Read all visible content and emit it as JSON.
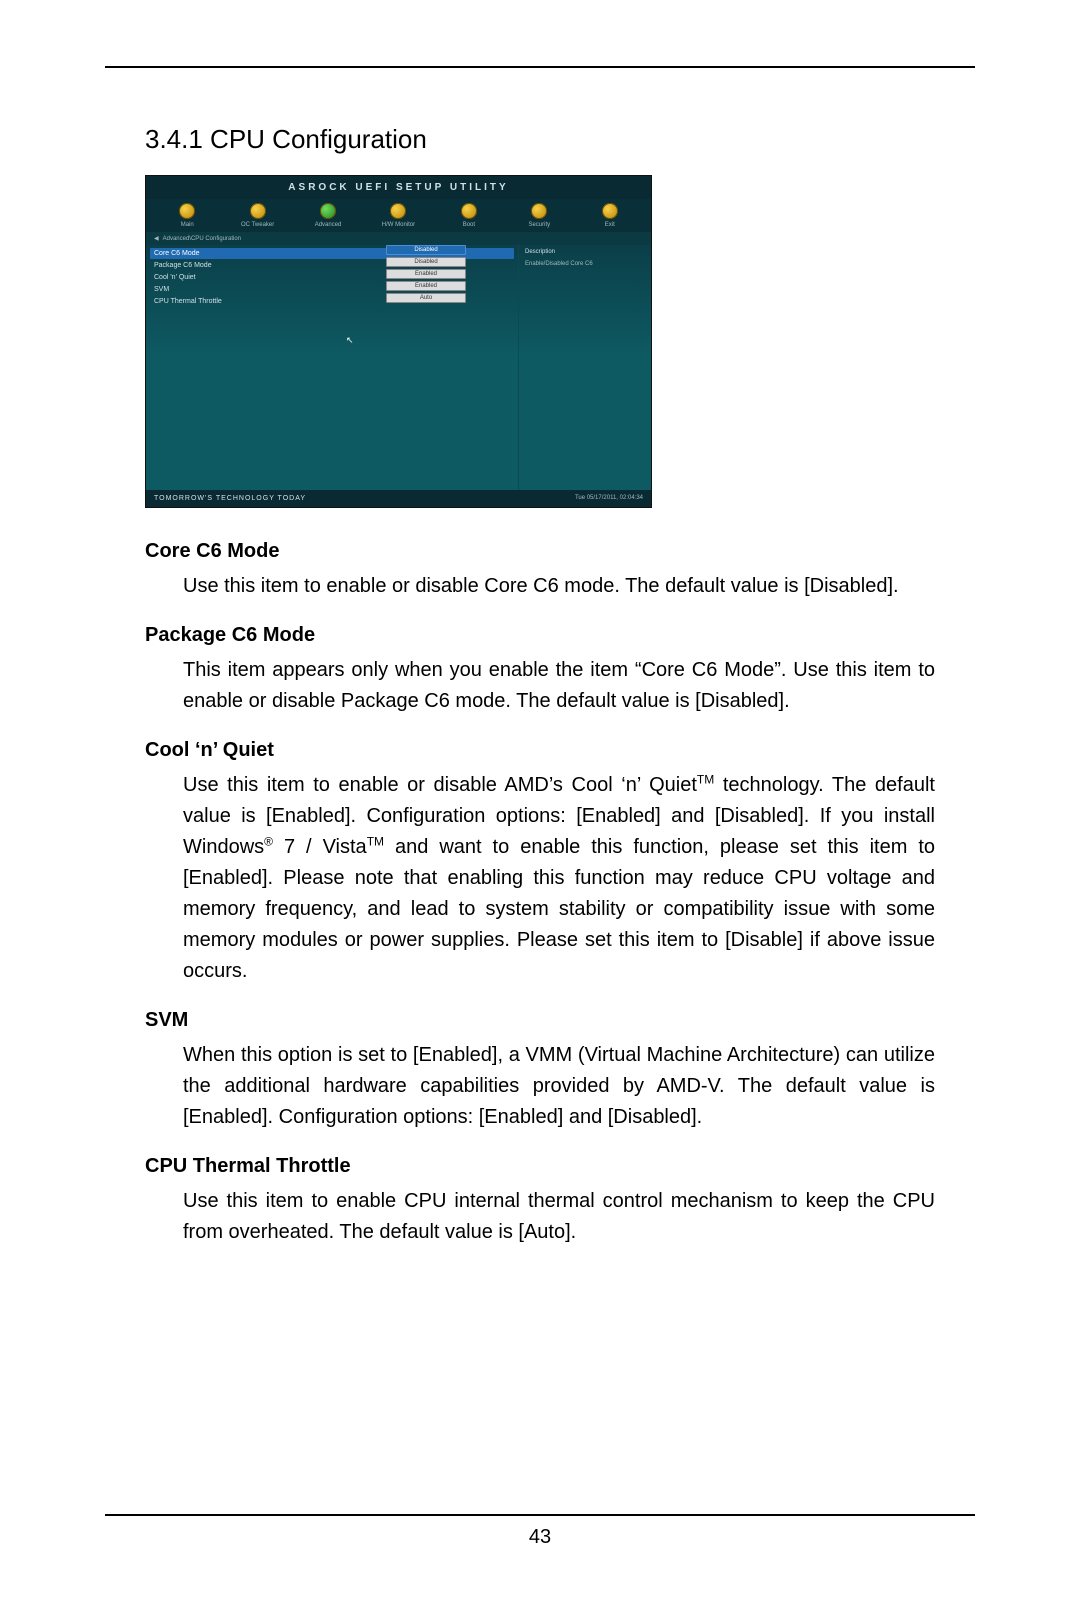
{
  "section_title": "3.4.1  CPU Configuration",
  "page_number": "43",
  "bios": {
    "header": "ASROCK UEFI SETUP UTILITY",
    "menu": [
      {
        "label": "Main"
      },
      {
        "label": "OC Tweaker"
      },
      {
        "label": "Advanced"
      },
      {
        "label": "H/W Monitor"
      },
      {
        "label": "Boot"
      },
      {
        "label": "Security"
      },
      {
        "label": "Exit"
      }
    ],
    "breadcrumb": "Advanced\\CPU Configuration",
    "rows": [
      {
        "label": "Core C6 Mode",
        "value": "Disabled",
        "selected": true
      },
      {
        "label": "Package C6 Mode",
        "value": "Disabled"
      },
      {
        "label": "Cool 'n' Quiet",
        "value": "Enabled"
      },
      {
        "label": "SVM",
        "value": "Enabled"
      },
      {
        "label": "CPU Thermal Throttle",
        "value": "Auto"
      }
    ],
    "options": [
      {
        "label": "Disabled",
        "selected": true
      },
      {
        "label": "Disabled"
      },
      {
        "label": "Enabled"
      },
      {
        "label": "Enabled"
      },
      {
        "label": "Auto"
      }
    ],
    "side_header": "Description",
    "side_text": "Enable/Disabled Core C6",
    "footer_left": "TOMORROW'S TECHNOLOGY TODAY",
    "footer_right": "Tue 05/17/2011, 02:04:34"
  },
  "items": [
    {
      "title": "Core C6 Mode",
      "desc": "Use this item to enable or disable Core C6 mode. The default value is [Disabled]."
    },
    {
      "title": "Package C6 Mode",
      "desc": "This item appears only when you enable the item “Core C6 Mode”. Use this item to enable or disable Package C6 mode. The default value is [Disabled]."
    },
    {
      "title": "Cool ‘n’ Quiet",
      "desc_html": "Use this item to enable or disable AMD’s Cool ‘n’ Quiet<sup>TM</sup> technology. The default value is [Enabled]. Configuration options: [Enabled] and [Disabled]. If you install Windows<sup>®</sup> 7 / Vista<sup>TM</sup> and want to enable this function, please set this item to [Enabled]. Please note that enabling this function may reduce CPU voltage and memory frequency, and lead to system stability or compatibility issue with some memory modules or power supplies. Please set this item to [Disable] if above issue occurs."
    },
    {
      "title": "SVM",
      "desc": "When this option is set to [Enabled], a VMM (Virtual Machine Architecture) can utilize the additional hardware capabilities provided by AMD-V. The default value is [Enabled]. Configuration options: [Enabled] and [Disabled]."
    },
    {
      "title": "CPU Thermal Throttle",
      "desc": "Use this item to enable CPU internal thermal control mechanism to keep the CPU from overheated. The default value is [Auto]."
    }
  ]
}
